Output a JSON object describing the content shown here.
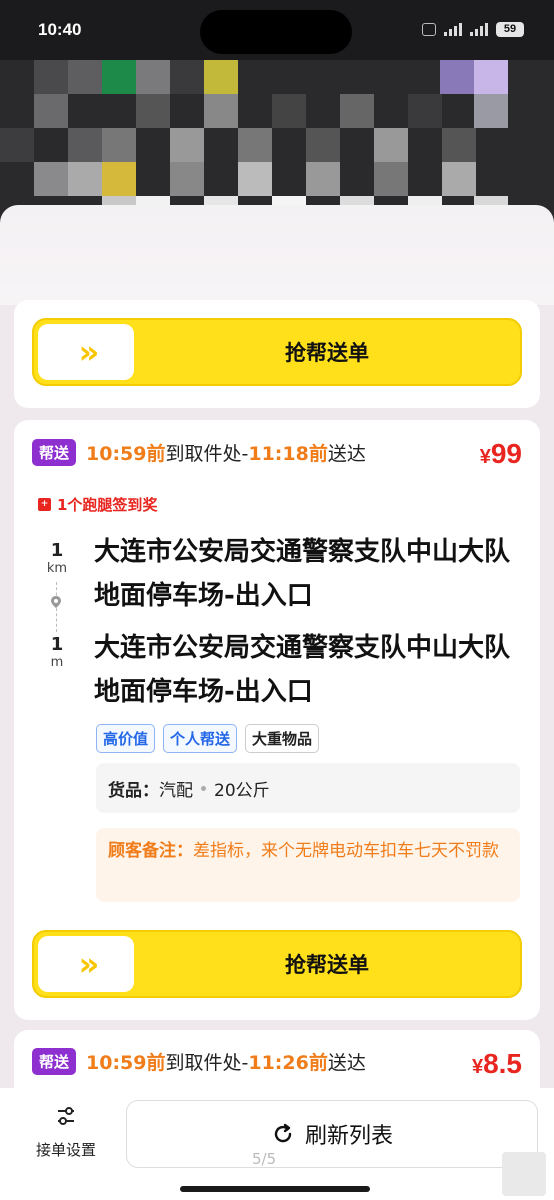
{
  "status_bar": {
    "time": "10:40",
    "battery": "59"
  },
  "first_card": {
    "grab_button_label": "抢帮送单",
    "grab_chevron": "»"
  },
  "order1": {
    "type_tag": "帮送",
    "pickup_time": "10:59前",
    "pickup_text": "到取件处-",
    "deliver_time": "11:18前",
    "deliver_text": "送达",
    "price_currency": "¥",
    "price_value": "99",
    "reward": "1个跑腿签到奖",
    "pickup_distance": {
      "num": "1",
      "unit": "km"
    },
    "deliver_distance": {
      "num": "1",
      "unit": "m"
    },
    "pickup_address": "大连市公安局交通警察支队中山大队地面停车场-出入口",
    "deliver_address": "大连市公安局交通警察支队中山大队地面停车场-出入口",
    "tags": [
      "高价值",
      "个人帮送",
      "大重物品"
    ],
    "goods_label": "货品：",
    "goods_name": "汽配",
    "goods_weight": "20公斤",
    "note_label": "顾客备注：",
    "note_text": "差指标，来个无牌电动车扣车七天不罚款",
    "grab_button_label": "抢帮送单",
    "grab_chevron": "»"
  },
  "order2": {
    "type_tag": "帮送",
    "pickup_time": "10:59前",
    "pickup_text": "到取件处-",
    "deliver_time": "11:26前",
    "deliver_text": "送达",
    "price_currency": "¥",
    "price_value": "8.5"
  },
  "bottom": {
    "settings_label": "接单设置",
    "refresh_label": "刷新列表",
    "pager": "5/5"
  }
}
